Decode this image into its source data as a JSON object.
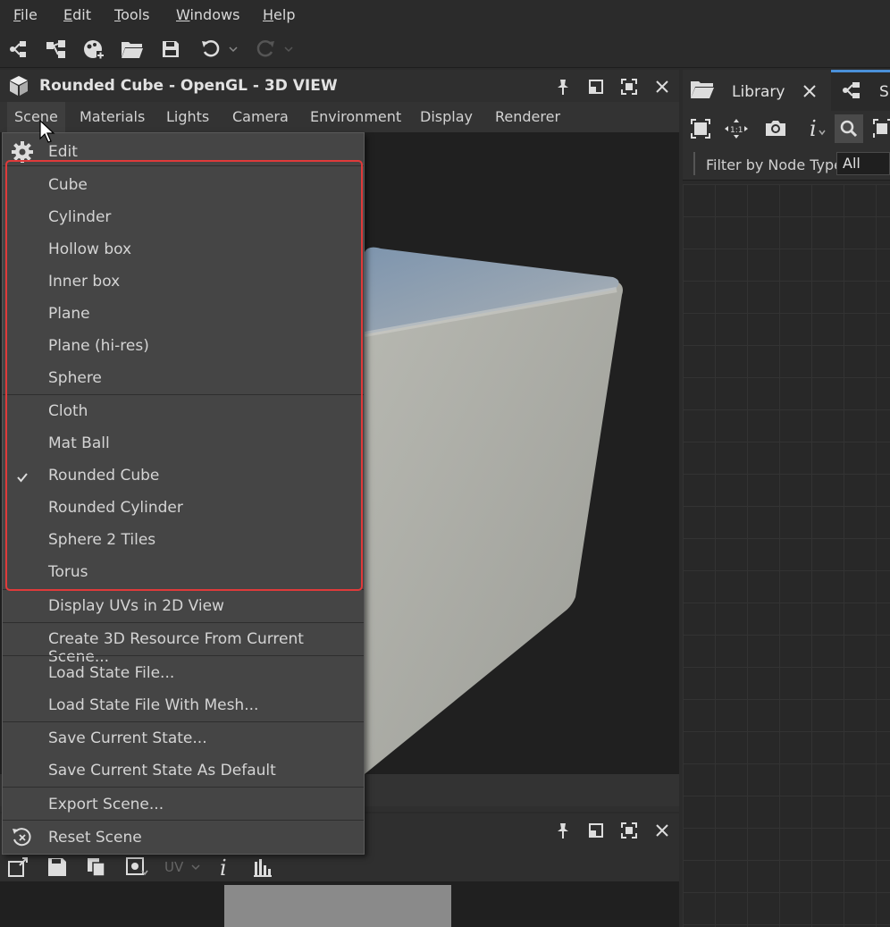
{
  "menubar": {
    "items": [
      {
        "pre": "",
        "u": "F",
        "post": "ile"
      },
      {
        "pre": "",
        "u": "E",
        "post": "dit"
      },
      {
        "pre": "",
        "u": "T",
        "post": "ools"
      },
      {
        "pre": "",
        "u": "W",
        "post": "indows"
      },
      {
        "pre": "",
        "u": "H",
        "post": "elp"
      }
    ]
  },
  "view3d": {
    "title": "Rounded Cube - OpenGL - 3D VIEW",
    "menus": [
      "Scene",
      "Materials",
      "Lights",
      "Camera",
      "Environment",
      "Display",
      "Renderer"
    ]
  },
  "dropdown": {
    "edit_label": "Edit",
    "meshes": [
      "Cube",
      "Cylinder",
      "Hollow box",
      "Inner box",
      "Plane",
      "Plane (hi-res)",
      "Sphere"
    ],
    "meshes2": [
      "Cloth",
      "Mat Ball",
      "Rounded Cube",
      "Rounded Cylinder",
      "Sphere 2 Tiles",
      "Torus"
    ],
    "checked": "Rounded Cube",
    "display_uvs": "Display UVs in 2D View",
    "create_resource": "Create 3D Resource From Current Scene...",
    "load_state": "Load State File...",
    "load_state_mesh": "Load State File With Mesh...",
    "save_state": "Save Current State...",
    "save_default": "Save Current State As Default",
    "export": "Export Scene...",
    "reset": "Reset Scene"
  },
  "rightpanel": {
    "library_tab": "Library",
    "second_tab": "S",
    "filter_label": "Filter by Node Type",
    "filter_value": "All"
  },
  "view2d": {
    "uv_label": "UV"
  },
  "colors": {
    "highlight": "#e03a3a",
    "active_tab": "#4a90d9"
  }
}
